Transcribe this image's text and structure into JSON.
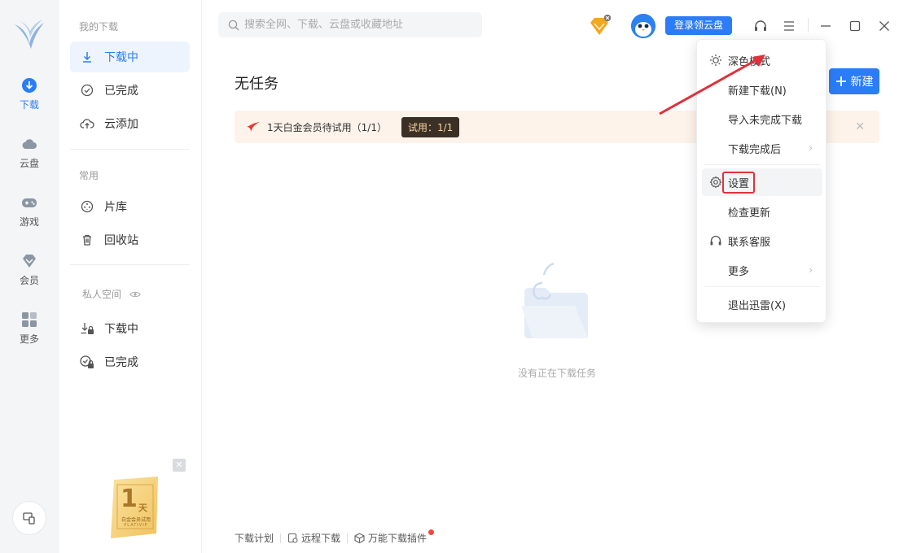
{
  "rail": {
    "items": [
      {
        "label": "下载",
        "icon": "download-circle-icon",
        "active": true
      },
      {
        "label": "云盘",
        "icon": "cloud-icon"
      },
      {
        "label": "游戏",
        "icon": "gamepad-icon"
      },
      {
        "label": "会员",
        "icon": "diamond-icon"
      },
      {
        "label": "更多",
        "icon": "grid-icon"
      }
    ]
  },
  "nav": {
    "section_downloads": "我的下载",
    "downloading": "下载中",
    "completed": "已完成",
    "cloud_add": "云添加",
    "section_common": "常用",
    "library": "片库",
    "recycle": "回收站",
    "section_private": "私人空间",
    "private_downloading": "下载中",
    "private_completed": "已完成",
    "promo": {
      "days": "1",
      "unit": "天",
      "line": "白金会员试用",
      "sub": "PLATIVIP"
    }
  },
  "header": {
    "search_placeholder": "搜索全网、下载、云盘或收藏地址",
    "login_button": "登录领云盘"
  },
  "main": {
    "title": "无任务",
    "new_button": "新建",
    "banner": {
      "text": "1天白金会员待试用（1/1）",
      "badge": "试用：1/1"
    },
    "empty_text": "没有正在下载任务"
  },
  "footer": {
    "plan": "下载计划",
    "remote": "远程下载",
    "plugin": "万能下载插件"
  },
  "menu": {
    "dark_mode": "深色模式",
    "new_download": "新建下载(N)",
    "import_unfinished": "导入未完成下载",
    "after_complete": "下载完成后",
    "settings": "设置",
    "check_update": "检查更新",
    "support": "联系客服",
    "more": "更多",
    "exit": "退出迅雷(X)"
  },
  "colors": {
    "accent": "#2b7cf6",
    "highlight_box": "#e0313b",
    "banner_bg": "#fdf3ea"
  }
}
